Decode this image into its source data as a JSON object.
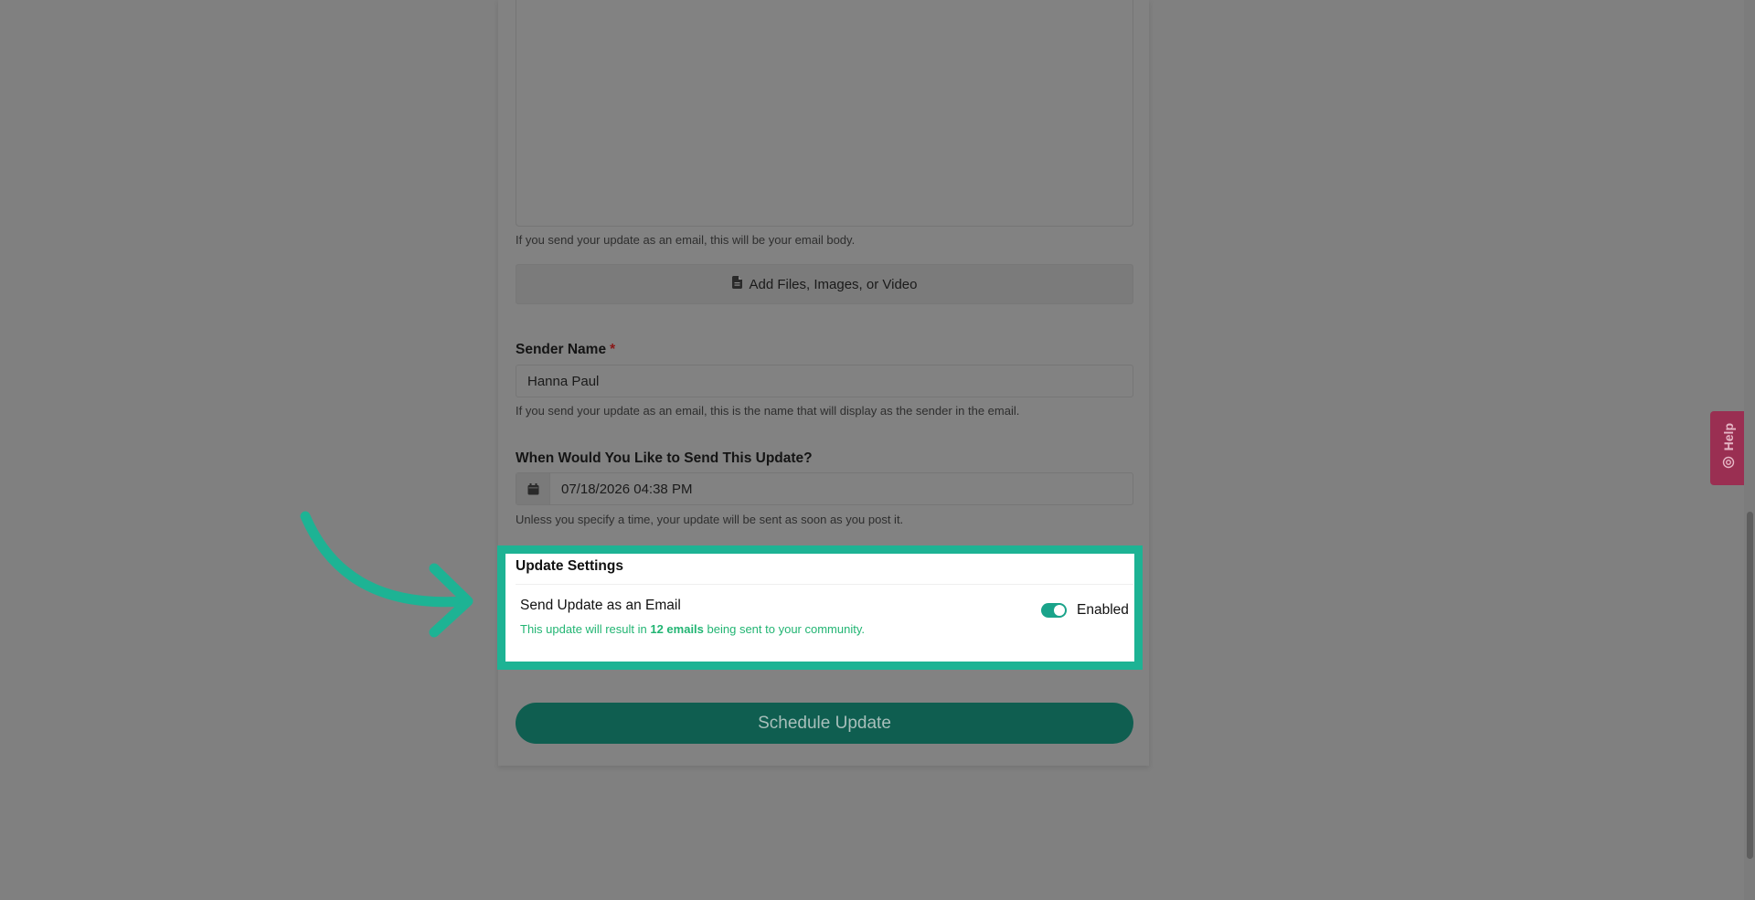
{
  "form": {
    "body_hint": "If you send your update as an email, this will be your email body.",
    "add_files_label": "Add Files, Images, or Video",
    "sender": {
      "label": "Sender Name",
      "required_mark": "*",
      "value": "Hanna Paul",
      "hint": "If you send your update as an email, this is the name that will display as the sender in the email."
    },
    "schedule": {
      "label": "When Would You Like to Send This Update?",
      "value": "07/18/2026 04:38 PM",
      "hint": "Unless you specify a time, your update will be sent as soon as you post it."
    },
    "settings": {
      "title": "Update Settings",
      "email_option_label": "Send Update as an Email",
      "note_prefix": "This update will result in",
      "note_count": "12 emails",
      "note_suffix": "being sent to your community.",
      "toggle_state": "Enabled",
      "toggle_on": true
    },
    "submit_label": "Schedule Update"
  },
  "help_tab": {
    "label": "Help"
  },
  "colors": {
    "highlight": "#1db394",
    "toggle_on": "#1aa38a",
    "note_green": "#22b573",
    "submit_bg": "#0f5e50",
    "help_bg": "#9a2f52"
  },
  "icons": [
    "file-icon",
    "calendar-icon",
    "annotation-arrow-icon",
    "lifebuoy-icon"
  ]
}
